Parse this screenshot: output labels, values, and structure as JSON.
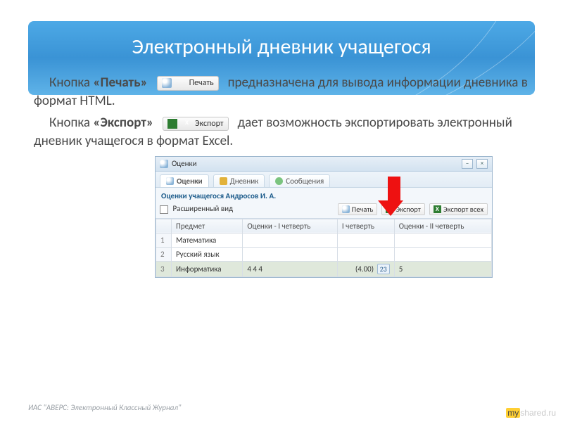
{
  "slide": {
    "title": "Электронный дневник учащегося",
    "p1_a": "Кнопка ",
    "p1_bold": "«Печать»",
    "p1_btn": "Печать",
    "p1_b": " предназначена для вывода информации дневника в формат HTML.",
    "p2_a": "Кнопка ",
    "p2_bold": "«Экспорт»",
    "p2_btn": "Экспорт",
    "p2_b": " дает возможность экспортировать электронный дневник учащегося в формат Excel."
  },
  "app": {
    "window_title": "Оценки",
    "tabs": [
      "Оценки",
      "Дневник",
      "Сообщения"
    ],
    "student_label": "Оценки учащегося Андросов И. А.",
    "expanded_label": "Расширенный вид",
    "toolbar": {
      "print": "Печать",
      "export": "Экспорт",
      "export_all": "Экспорт всех"
    },
    "columns": [
      "Предмет",
      "Оценки - I четверть",
      "I четверть",
      "Оценки - II четверть"
    ],
    "rows": [
      {
        "n": "1",
        "subject": "Математика",
        "g1": "",
        "q1": "",
        "g2": ""
      },
      {
        "n": "2",
        "subject": "Русский язык",
        "g1": "",
        "q1": "",
        "g2": ""
      },
      {
        "n": "3",
        "subject": "Информатика",
        "g1": "4 4 4",
        "q1": "(4.00)",
        "q1_badge": "23",
        "g2": "5"
      }
    ]
  },
  "footer": "ИАС \"АВЕРС: Электронный Классный Журнал\"",
  "watermark": {
    "my": "my",
    "rest": "shared.ru"
  }
}
